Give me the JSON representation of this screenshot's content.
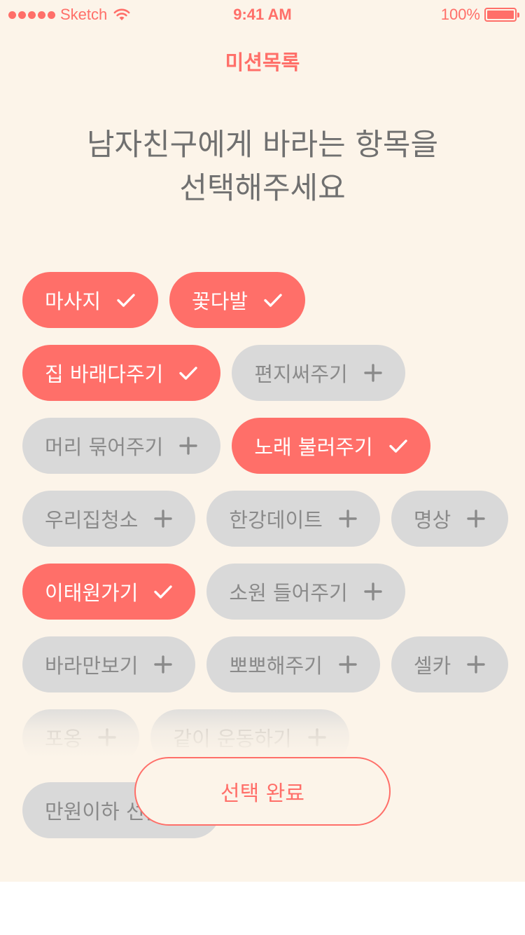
{
  "status_bar": {
    "carrier": "Sketch",
    "time": "9:41 AM",
    "battery": "100%"
  },
  "nav": {
    "title": "미션목록"
  },
  "headline": {
    "line1": "남자친구에게 바라는 항목을",
    "line2": "선택해주세요"
  },
  "chips": [
    {
      "label": "마사지",
      "selected": true
    },
    {
      "label": "꽃다발",
      "selected": true
    },
    {
      "label": "집 바래다주기",
      "selected": true
    },
    {
      "label": "편지써주기",
      "selected": false
    },
    {
      "label": "머리 묶어주기",
      "selected": false
    },
    {
      "label": "노래 불러주기",
      "selected": true
    },
    {
      "label": "우리집청소",
      "selected": false
    },
    {
      "label": "한강데이트",
      "selected": false
    },
    {
      "label": "명상",
      "selected": false
    },
    {
      "label": "이태원가기",
      "selected": true
    },
    {
      "label": "소원 들어주기",
      "selected": false
    },
    {
      "label": "바라만보기",
      "selected": false
    },
    {
      "label": "뽀뽀해주기",
      "selected": false
    },
    {
      "label": "셀카",
      "selected": false
    },
    {
      "label": "포옹",
      "selected": false
    },
    {
      "label": "같이 운동하기",
      "selected": false
    },
    {
      "label": "만원이하 선물",
      "selected": false
    }
  ],
  "icons": {
    "selected": "check-icon",
    "unselected": "plus-icon"
  },
  "done_button": {
    "label": "선택 완료"
  },
  "colors": {
    "accent": "#ff6f69",
    "background": "#fcf4e9",
    "chip_off": "#d9d9d9",
    "chip_off_text": "#8a8a8a"
  }
}
